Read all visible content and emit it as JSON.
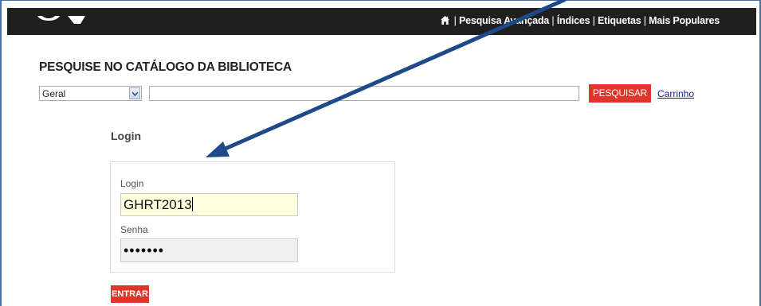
{
  "header": {
    "nav": [
      "Pesquisa Avançada",
      "Índices",
      "Etiquetas",
      "Mais Populares"
    ],
    "separator": "|",
    "icon": "home-icon"
  },
  "search": {
    "title": "PESQUISE NO CATÁLOGO DA BIBLIOTECA",
    "scope_value": "Geral",
    "query_value": "",
    "button_label": "PESQUISAR",
    "cart_label": "Carrinho"
  },
  "login": {
    "heading": "Login",
    "login_label": "Login",
    "login_value": "GHRT2013",
    "password_label": "Senha",
    "password_value": "•••••••",
    "submit_label": "ENTRAR"
  },
  "colors": {
    "topbar": "#1f1f1f",
    "accent_red": "#e0352a",
    "annotation_arrow": "#1f4a8a",
    "login_field_bg": "#ffffe0"
  }
}
